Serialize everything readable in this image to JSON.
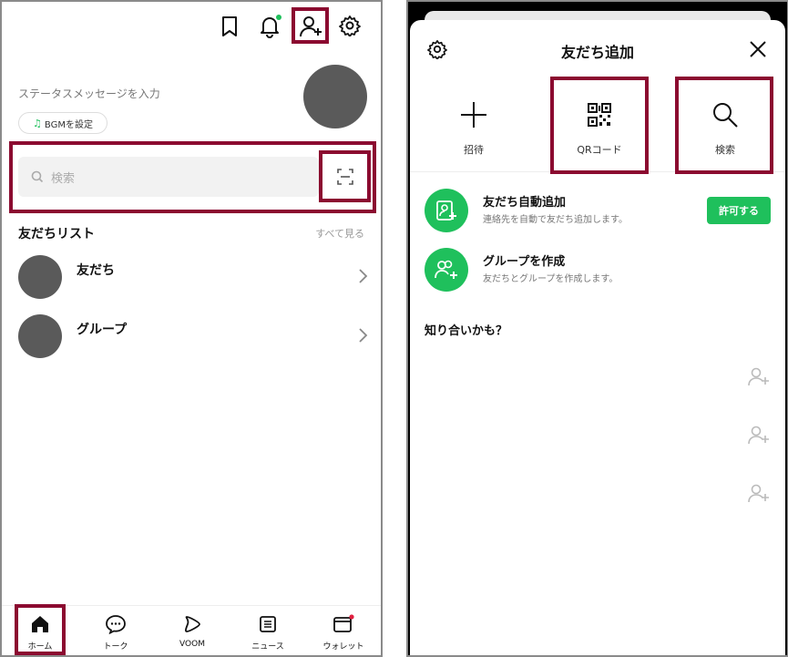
{
  "home": {
    "status_placeholder": "ステータスメッセージを入力",
    "bgm_label": "BGMを設定",
    "search_placeholder": "検索",
    "friends_list_title": "友だちリスト",
    "see_all": "すべて見る",
    "rows": [
      {
        "label": "友だち"
      },
      {
        "label": "グループ"
      }
    ],
    "nav": [
      {
        "label": "ホーム",
        "icon": "home-icon"
      },
      {
        "label": "トーク",
        "icon": "chat-icon"
      },
      {
        "label": "VOOM",
        "icon": "voom-icon"
      },
      {
        "label": "ニュース",
        "icon": "news-icon"
      },
      {
        "label": "ウォレット",
        "icon": "wallet-icon"
      }
    ]
  },
  "add_friends": {
    "title": "友だち追加",
    "tiles": [
      {
        "label": "招待",
        "icon": "plus-icon"
      },
      {
        "label": "QRコード",
        "icon": "qr-code-icon"
      },
      {
        "label": "検索",
        "icon": "search-icon"
      }
    ],
    "options": [
      {
        "title": "友だち自動追加",
        "desc": "連絡先を自動で友だち追加します。"
      },
      {
        "title": "グループを作成",
        "desc": "友だちとグループを作成します。"
      }
    ],
    "allow_label": "許可する",
    "suggestions_title": "知り合いかも？"
  },
  "colors": {
    "accent_green": "#1fc05c",
    "highlight": "#8b0a30",
    "notification_dot_green": "#1fc05c",
    "notification_dot_red": "#e02040"
  }
}
